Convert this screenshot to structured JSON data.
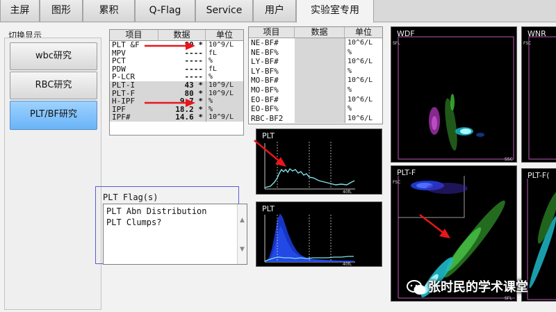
{
  "tabs": [
    {
      "label": "主屏",
      "active": false
    },
    {
      "label": "图形",
      "active": false
    },
    {
      "label": "累积",
      "active": false
    },
    {
      "label": "Q-Flag",
      "active": false
    },
    {
      "label": "Service",
      "active": false
    },
    {
      "label": "用户",
      "active": false
    },
    {
      "label": "实验室专用",
      "active": true
    }
  ],
  "left_panel": {
    "title": "切换显示",
    "buttons": [
      {
        "label": "wbc研究",
        "active": false
      },
      {
        "label": "RBC研究",
        "active": false
      },
      {
        "label": "PLT/BF研究",
        "active": true
      }
    ]
  },
  "plt_table": {
    "headers": [
      "项目",
      "数据",
      "单位"
    ],
    "rows": [
      {
        "item": "PLT &F",
        "value": "80",
        "flag": "*",
        "unit": "10^9/L",
        "gray": false
      },
      {
        "item": "MPV",
        "value": "----",
        "flag": "",
        "unit": "fL",
        "gray": false
      },
      {
        "item": "PCT",
        "value": "----",
        "flag": "",
        "unit": "%",
        "gray": false
      },
      {
        "item": "PDW",
        "value": "----",
        "flag": "",
        "unit": "fL",
        "gray": false
      },
      {
        "item": "P-LCR",
        "value": "----",
        "flag": "",
        "unit": "%",
        "gray": false
      },
      {
        "item": "PLT-I",
        "value": "43",
        "flag": "*",
        "unit": "10^9/L",
        "gray": true
      },
      {
        "item": "PLT-F",
        "value": "80",
        "flag": "*",
        "unit": "10^9/L",
        "gray": true
      },
      {
        "item": "H-IPF",
        "value": "9.7",
        "flag": "*",
        "unit": "%",
        "gray": true
      },
      {
        "item": "IPF",
        "value": "18.2",
        "flag": "*",
        "unit": "%",
        "gray": true
      },
      {
        "item": "IPF#",
        "value": "14.6",
        "flag": "*",
        "unit": "10^9/L",
        "gray": true
      }
    ]
  },
  "bf_table": {
    "headers": [
      "项目",
      "数据",
      "单位"
    ],
    "rows": [
      {
        "item": "NE-BF#",
        "value": "",
        "unit": "10^6/L"
      },
      {
        "item": "NE-BF%",
        "value": "",
        "unit": "%"
      },
      {
        "item": "LY-BF#",
        "value": "",
        "unit": "10^6/L"
      },
      {
        "item": "LY-BF%",
        "value": "",
        "unit": "%"
      },
      {
        "item": "MO-BF#",
        "value": "",
        "unit": "10^6/L"
      },
      {
        "item": "MO-BF%",
        "value": "",
        "unit": "%"
      },
      {
        "item": "EO-BF#",
        "value": "",
        "unit": "10^6/L"
      },
      {
        "item": "EO-BF%",
        "value": "",
        "unit": "%"
      },
      {
        "item": "RBC-BF2",
        "value": "",
        "unit": "10^6/L"
      }
    ]
  },
  "histograms": [
    {
      "title": "PLT",
      "x_end_label": "40fL"
    },
    {
      "title": "PLT",
      "x_end_label": "40fL"
    }
  ],
  "scattergrams": {
    "wdf": {
      "title": "WDF",
      "x_label": "SSC",
      "y_label": "SFL"
    },
    "wnr": {
      "title": "WNR",
      "y_label": "FSC"
    },
    "pltf": {
      "title": "PLT-F",
      "x_label": "SFL",
      "y_label": "FSC"
    },
    "pltf2": {
      "title": "PLT-F("
    }
  },
  "flags": {
    "title": "PLT Flag(s)",
    "lines": [
      "PLT Abn Distribution",
      "PLT Clumps?"
    ]
  },
  "watermark": "张时民的学术课堂",
  "colors": {
    "accent": "#6ab4f7",
    "arrow": "#e8161a"
  }
}
